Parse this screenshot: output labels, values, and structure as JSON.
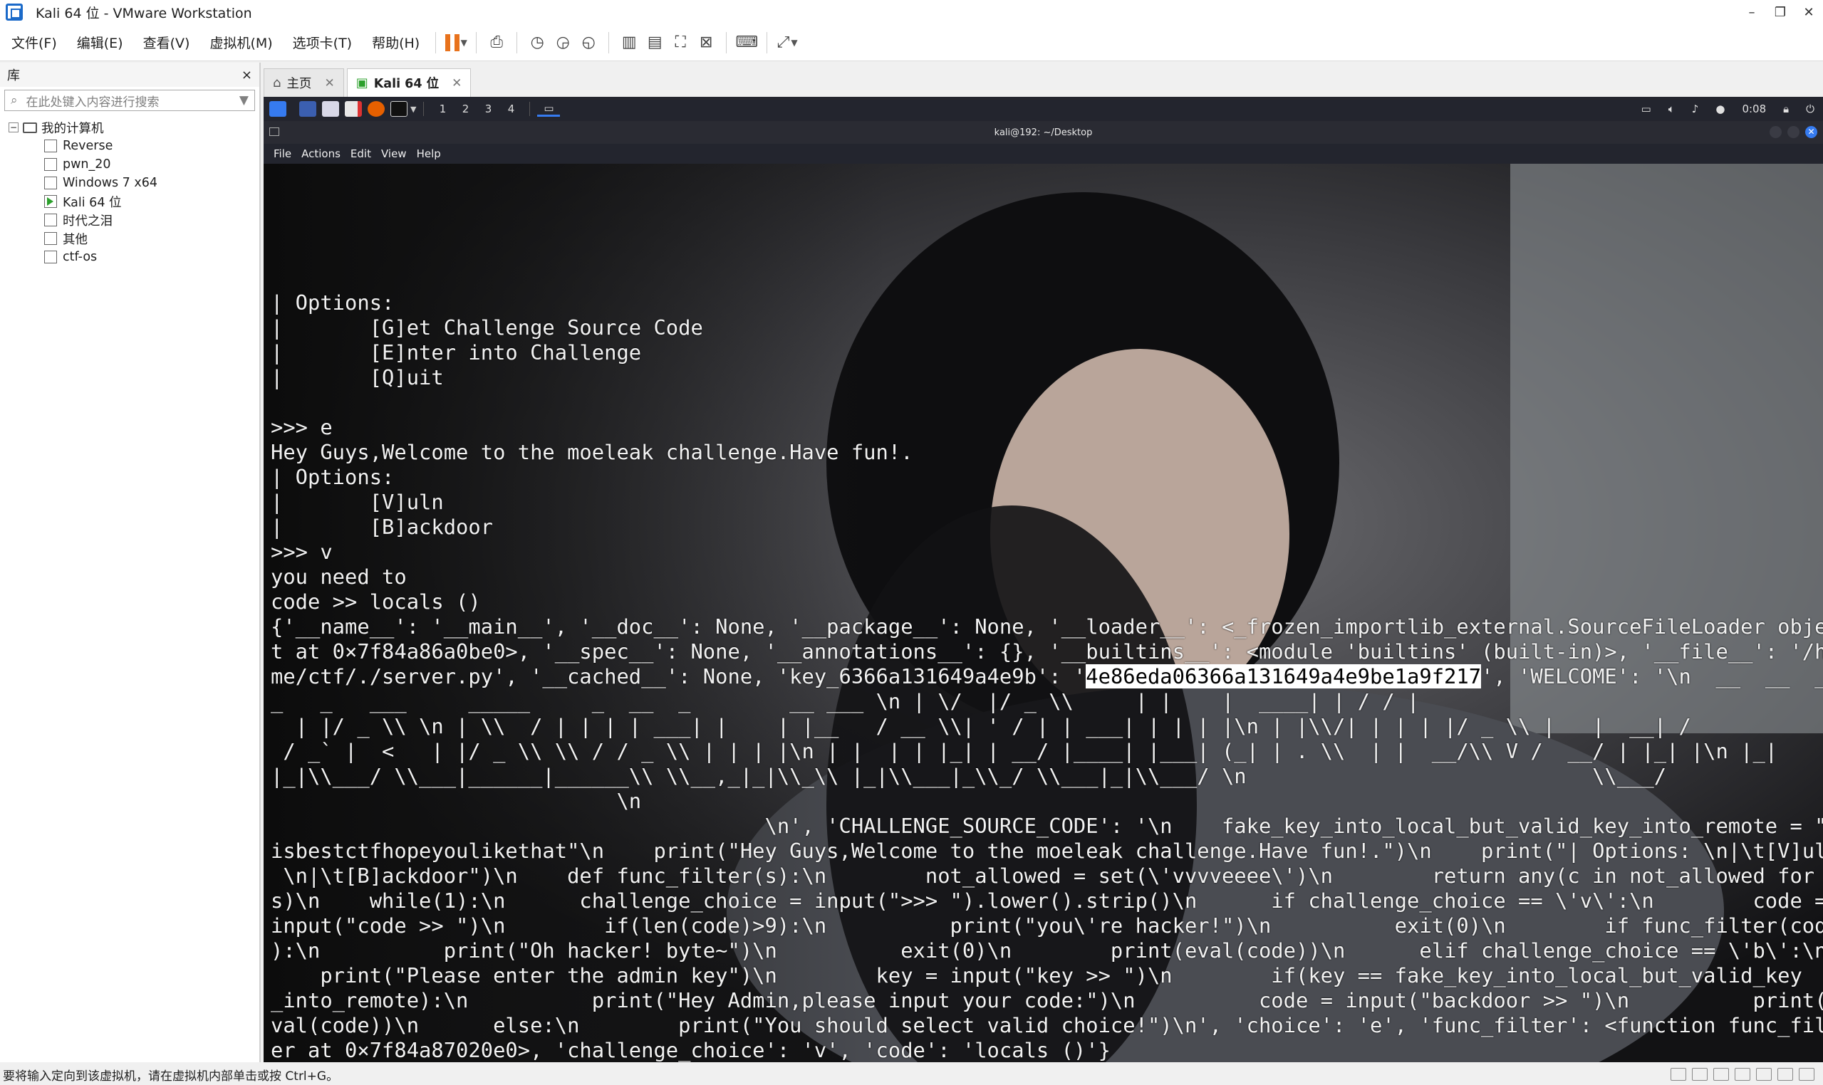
{
  "window": {
    "title": "Kali 64 位 - VMware Workstation",
    "minimize": "–",
    "restore": "❐",
    "close": "✕"
  },
  "menu": [
    "文件(F)",
    "编辑(E)",
    "查看(V)",
    "虚拟机(M)",
    "选项卡(T)",
    "帮助(H)"
  ],
  "library": {
    "title": "库",
    "close": "×",
    "search_placeholder": "在此处键入内容进行搜索",
    "root": "我的计算机",
    "expander": "−",
    "vms": [
      "Reverse",
      "pwn_20",
      "Windows 7 x64",
      "Kali 64 位",
      "时代之泪",
      "其他",
      "ctf-os"
    ],
    "running_index": 3
  },
  "tabs": [
    {
      "label": "主页",
      "icon": "home-icon",
      "active": false
    },
    {
      "label": "Kali 64 位",
      "icon": "vm-running-icon",
      "active": true
    }
  ],
  "kali": {
    "workspaces": [
      "1",
      "2",
      "3",
      "4"
    ],
    "clock": "0:08",
    "terminal_title": "kali@192: ~/Desktop",
    "terminal_menu": [
      "File",
      "Actions",
      "Edit",
      "View",
      "Help"
    ]
  },
  "terminal": {
    "lines_before": [
      "",
      "",
      "| Options:",
      "|       [G]et Challenge Source Code",
      "|       [E]nter into Challenge",
      "|       [Q]uit",
      "",
      ">>> e",
      "Hey Guys,Welcome to the moeleak challenge.Have fun!.",
      "| Options:",
      "|       [V]uln",
      "|       [B]ackdoor",
      ">>> v",
      "you need to",
      "code >> locals ()",
      "{'__name__': '__main__', '__doc__': None, '__package__': None, '__loader__': <_frozen_importlib_external.SourceFileLoader objec",
      "t at 0×7f84a86a0be0>, '__spec__': None, '__annotations__': {}, '__builtins__': <module 'builtins' (built-in)>, '__file__': '/ho"
    ],
    "key_line_prefix": "me/ctf/./server.py', '__cached__': None, 'key_6366a131649a4e9b': '",
    "key_value": "4e86eda06366a131649a4e9be1a9f217",
    "key_line_suffix": "', 'WELCOME': '\\n  __  __  __",
    "lines_after": [
      "_   _   ___     _____     _  __  _        __ ___ \\n | \\/  |/ _ \\\\     | |    |  ____| | / / |",
      "  | |/ _ \\\\ \\n | \\\\  / | | | | ___| |    | |__   / __ \\\\| ' / | | ___| | | | |\\n | |\\\\/| | | | |/ _ \\\\ |   |  __| /",
      " / _` |  <   | |/ _ \\\\ \\\\ / / _ \\\\ | | | |\\n | |  | | |_| | __/ |____| |___| (_| | . \\\\  | |  __/\\\\ V /  __/ | |_| |\\n |_|",
      "|_|\\\\___/ \\\\___|______|______\\\\ \\\\__,_|_|\\\\_\\\\ |_|\\\\___|_\\\\_/ \\\\___|_|\\\\___/ \\n                            \\\\___/",
      "                            \\n",
      "                                        \\n', 'CHALLENGE_SOURCE_CODE': '\\n    fake_key_into_local_but_valid_key_into_remote = \"moectf",
      "isbestctfhopeyoulikethat\"\\n    print(\"Hey Guys,Welcome to the moeleak challenge.Have fun!.\")\\n    print(\"| Options: \\n|\\t[V]uln",
      " \\n|\\t[B]ackdoor\")\\n    def func_filter(s):\\n        not_allowed = set(\\'vvvveeee\\')\\n        return any(c in not_allowed for c in",
      "s)\\n    while(1):\\n      challenge_choice = input(\">>> \").lower().strip()\\n      if challenge_choice == \\'v\\':\\n        code =",
      "input(\"code >> \")\\n        if(len(code)>9):\\n          print(\"you\\'re hacker!\")\\n          exit(0)\\n        if func_filter(code",
      "):\\n          print(\"Oh hacker! byte~\")\\n          exit(0)\\n        print(eval(code))\\n      elif challenge_choice == \\'b\\':\\n",
      "    print(\"Please enter the admin key\")\\n        key = input(\"key >> \")\\n        if(key == fake_key_into_local_but_valid_key",
      "_into_remote):\\n          print(\"Hey Admin,please input your code:\")\\n          code = input(\"backdoor >> \")\\n          print(e",
      "val(code))\\n      else:\\n        print(\"You should select valid choice!\")\\n', 'choice': 'e', 'func_filter': <function func_filt",
      "er at 0×7f84a87020e0>, 'challenge_choice': 'v', 'code': 'locals ()'}"
    ],
    "prompt": ">>> "
  },
  "status": {
    "text": "要将输入定向到该虚拟机，请在虚拟机内部单击或按 Ctrl+G。"
  },
  "colors": {
    "accent": "#367bf0",
    "pause": "#e8721c",
    "panel": "#23252e"
  }
}
